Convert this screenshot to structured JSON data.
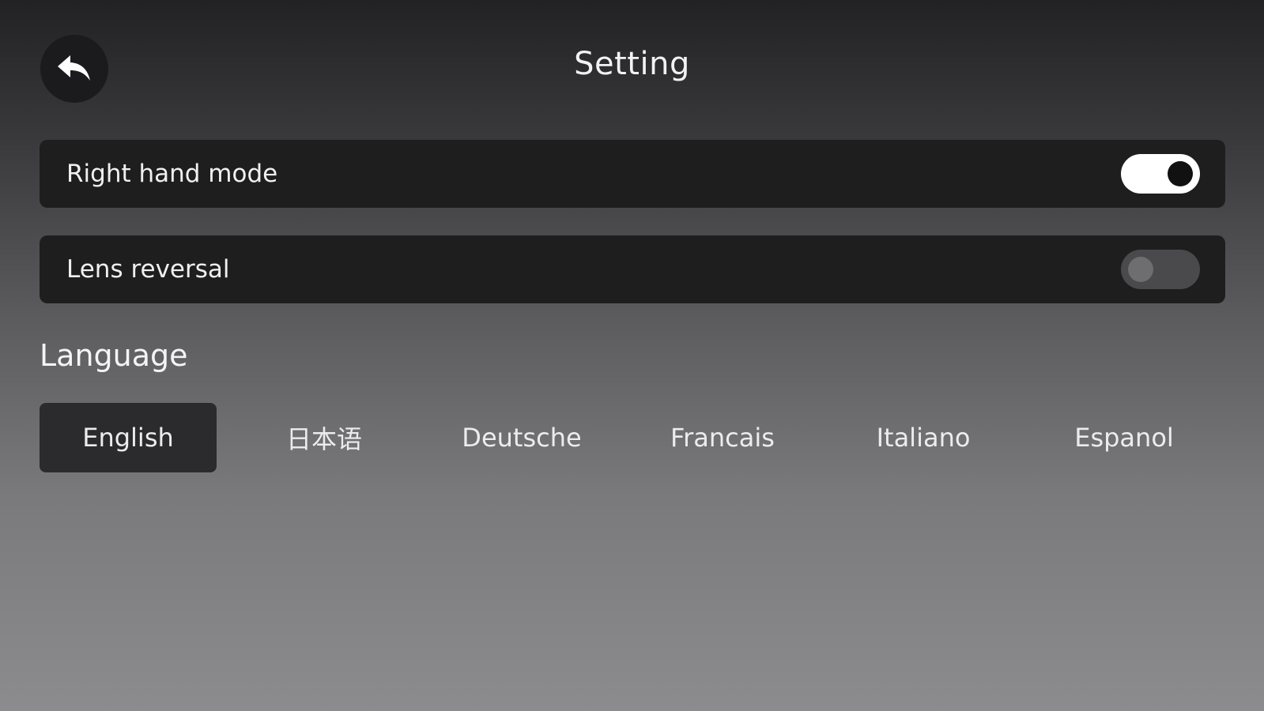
{
  "header": {
    "title": "Setting",
    "back_icon": "back-arrow-icon"
  },
  "settings": [
    {
      "label": "Right hand mode",
      "enabled": true
    },
    {
      "label": "Lens reversal",
      "enabled": false
    }
  ],
  "language": {
    "heading": "Language",
    "selected": "English",
    "options": [
      "English",
      "日本语",
      "Deutsche",
      "Francais",
      "Italiano",
      "Espanol"
    ]
  },
  "colors": {
    "toggle_on": "#ffffff",
    "toggle_off": "#4a494c",
    "row_bg": "#1e1e1f",
    "selected_language_bg": "#2b2a2c"
  }
}
